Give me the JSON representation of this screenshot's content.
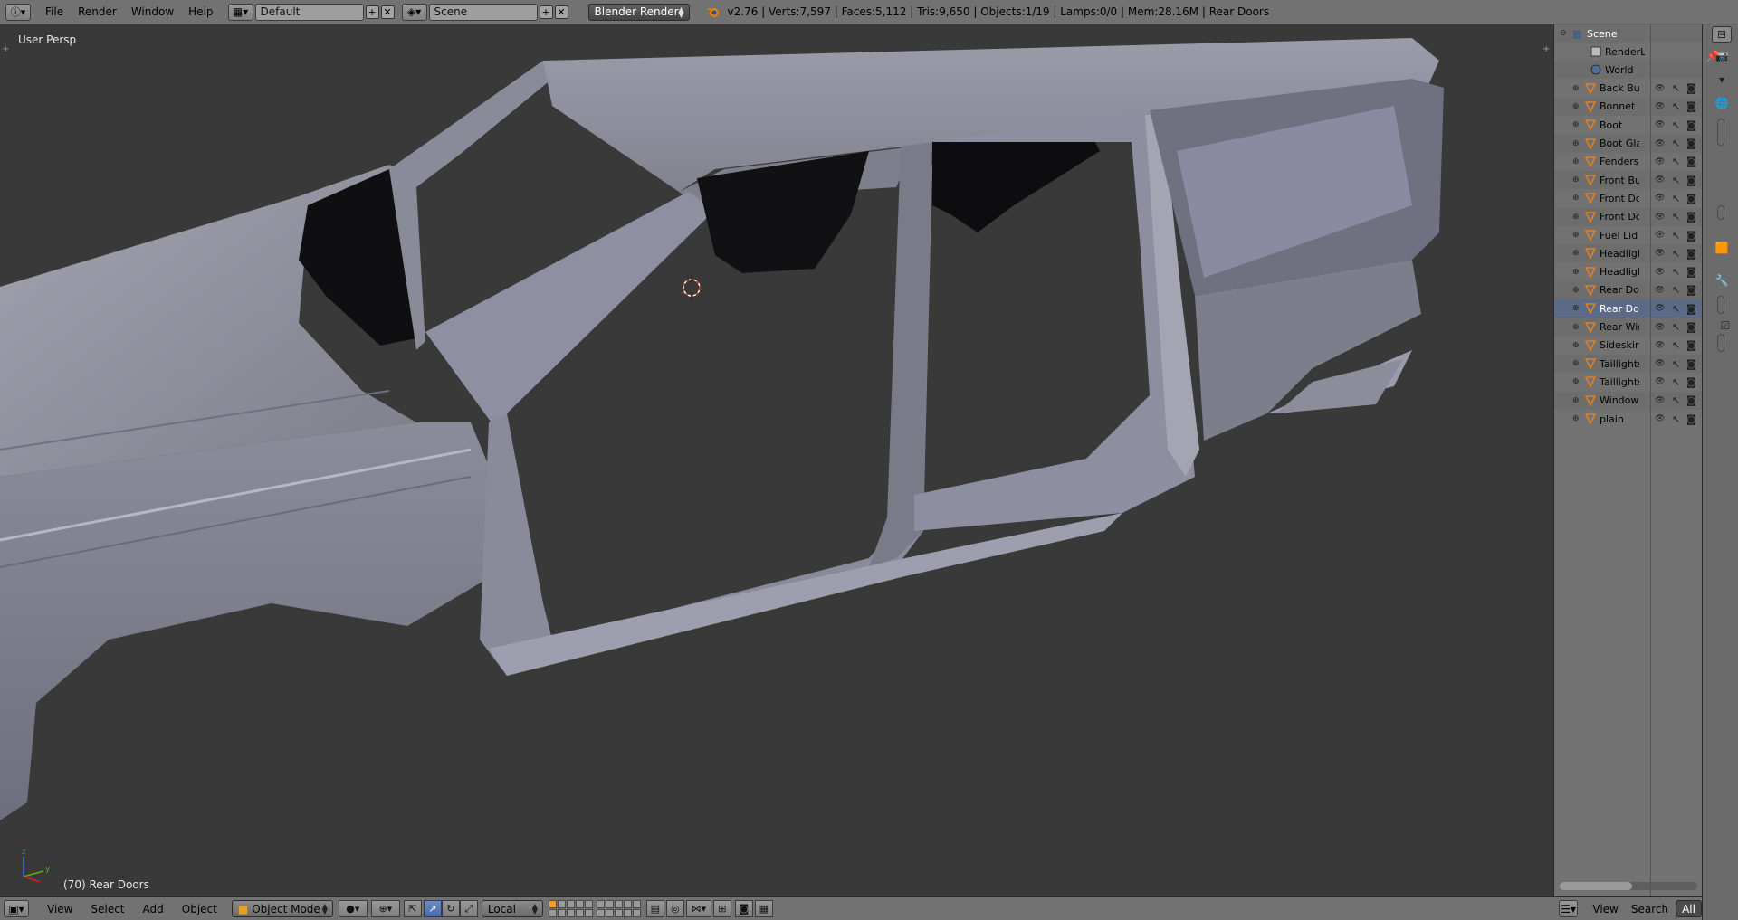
{
  "top_bar": {
    "menus": [
      "File",
      "Render",
      "Window",
      "Help"
    ],
    "layout_name": "Default",
    "scene_name": "Scene",
    "render_engine": "Blender Render",
    "stats": "v2.76 | Verts:7,597 | Faces:5,112 | Tris:9,650 | Objects:1/19 | Lamps:0/0 | Mem:28.16M | Rear Doors"
  },
  "viewport": {
    "view_label": "User Persp",
    "object_label": "(70) Rear Doors"
  },
  "bottom_bar": {
    "menus": [
      "View",
      "Select",
      "Add",
      "Object"
    ],
    "mode": "Object Mode",
    "pivot": "Local"
  },
  "outliner": {
    "root": "Scene",
    "items": [
      {
        "name": "RenderLayers",
        "type": "renderlayer"
      },
      {
        "name": "World",
        "type": "world"
      },
      {
        "name": "Back Bumper",
        "type": "mesh"
      },
      {
        "name": "Bonnet",
        "type": "mesh"
      },
      {
        "name": "Boot",
        "type": "mesh"
      },
      {
        "name": "Boot Glass",
        "type": "mesh"
      },
      {
        "name": "Fenders",
        "type": "mesh"
      },
      {
        "name": "Front Bumper",
        "type": "mesh"
      },
      {
        "name": "Front Doors",
        "type": "mesh"
      },
      {
        "name": "Front Doors",
        "type": "mesh"
      },
      {
        "name": "Fuel Lid",
        "type": "mesh"
      },
      {
        "name": "Headlights",
        "type": "mesh"
      },
      {
        "name": "Headlights",
        "type": "mesh"
      },
      {
        "name": "Rear Doors",
        "type": "mesh"
      },
      {
        "name": "Rear Doors",
        "type": "mesh",
        "selected": true
      },
      {
        "name": "Rear Windows",
        "type": "mesh"
      },
      {
        "name": "Sideskirts",
        "type": "mesh"
      },
      {
        "name": "Taillights",
        "type": "mesh"
      },
      {
        "name": "Taillights",
        "type": "mesh"
      },
      {
        "name": "Window",
        "type": "mesh"
      },
      {
        "name": "plain",
        "type": "mesh"
      }
    ],
    "footer_menus": [
      "View",
      "Search"
    ],
    "footer_filter": "All"
  },
  "colors": {
    "header_bg": "#727272",
    "viewport_bg": "#393939",
    "mesh_fill": "#8e8fa0",
    "selection": "#5b6a86"
  }
}
